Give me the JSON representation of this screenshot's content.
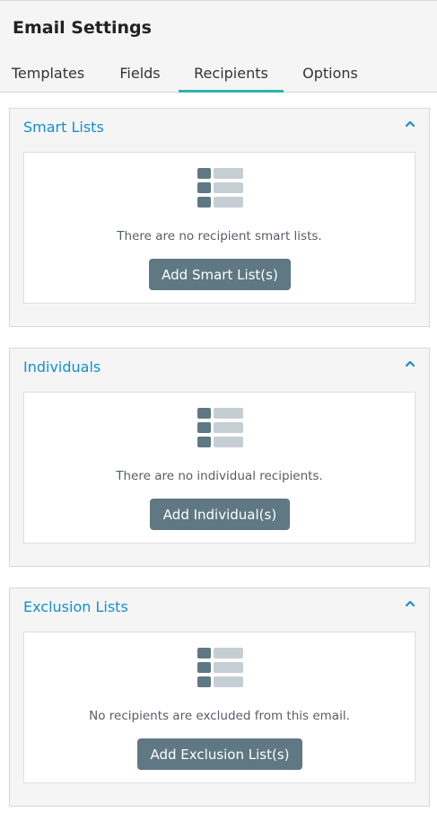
{
  "header": {
    "title": "Email Settings",
    "tabs": [
      "Templates",
      "Fields",
      "Recipients",
      "Options"
    ],
    "active_tab": "Recipients"
  },
  "sections": [
    {
      "title": "Smart Lists",
      "empty_message": "There are no recipient smart lists.",
      "button_label": "Add Smart List(s)"
    },
    {
      "title": "Individuals",
      "empty_message": "There are no individual recipients.",
      "button_label": "Add Individual(s)"
    },
    {
      "title": "Exclusion Lists",
      "empty_message": "No recipients are excluded from this email.",
      "button_label": "Add Exclusion List(s)"
    }
  ],
  "icons": {
    "collapse": "chevron-up-icon",
    "empty_state": "list-icon"
  },
  "colors": {
    "accent": "#1590cd",
    "tab_underline": "#2eb3a8",
    "button": "#5f7883",
    "icon_dark": "#5f7883",
    "icon_light": "#c5ced3"
  }
}
